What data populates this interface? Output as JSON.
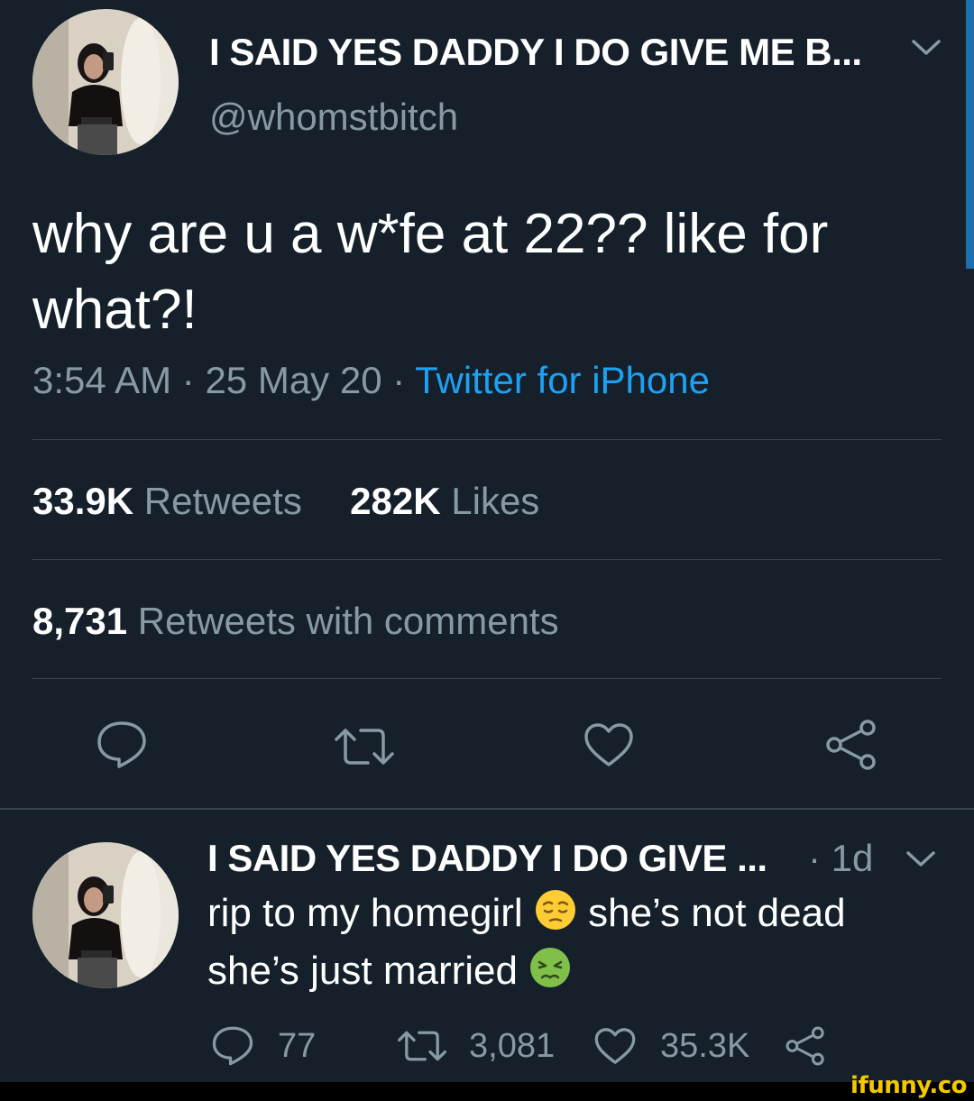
{
  "main_tweet": {
    "display_name": "I SAID YES DADDY I DO GIVE ME B...",
    "handle": "@whomstbitch",
    "text": "why are u a w*fe at 22?? like for what?!",
    "time": "3:54 AM",
    "separator": "·",
    "date": "25 May 20",
    "source": "Twitter for iPhone",
    "stats": {
      "retweets_count": "33.9K",
      "retweets_label": "Retweets",
      "likes_count": "282K",
      "likes_label": "Likes",
      "quote_count": "8,731",
      "quote_label": "Retweets with comments"
    },
    "icons": [
      "reply-icon",
      "retweet-icon",
      "like-icon",
      "share-icon"
    ]
  },
  "reply_tweet": {
    "display_name": "I SAID YES DADDY I DO GIVE ...",
    "age": "· 1d",
    "text_part1": "rip to my homegirl ",
    "text_part2": " she’s not dead she’s just married ",
    "emojis": [
      "pensive-face-emoji",
      "nauseated-face-emoji"
    ],
    "reply_count": "77",
    "retweet_count": "3,081",
    "like_count": "35.3K"
  },
  "watermark": "ifunny.co",
  "colors": {
    "background": "#15202b",
    "text": "#ffffff",
    "secondary": "#8899a6",
    "accent": "#1da1f2",
    "divider": "#38444d",
    "watermark": "#f4c800"
  }
}
